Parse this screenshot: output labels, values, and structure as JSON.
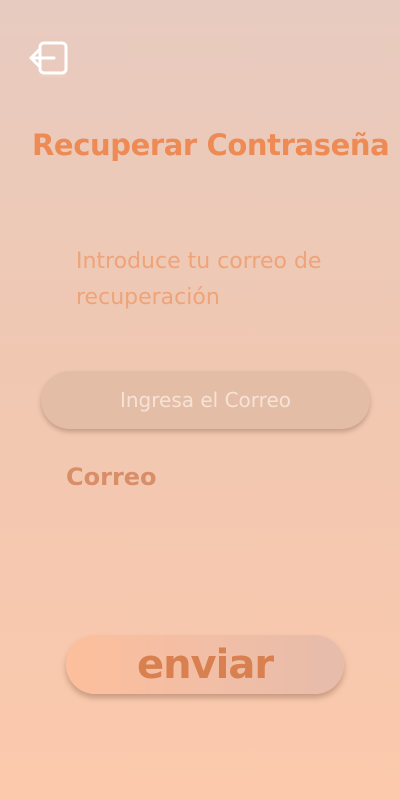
{
  "header": {
    "back_icon": "exit-back-arrow-icon",
    "title": "Recuperar Contraseña"
  },
  "form": {
    "instructions": "Introduce tu correo de recuperación",
    "email_placeholder": "Ingresa el Correo",
    "email_value": "",
    "email_label": "Correo",
    "submit_label": "enviar"
  },
  "colors": {
    "accent": "#ee8a54",
    "background_top": "#e8cbc0",
    "background_bottom": "#fcc9ac"
  }
}
